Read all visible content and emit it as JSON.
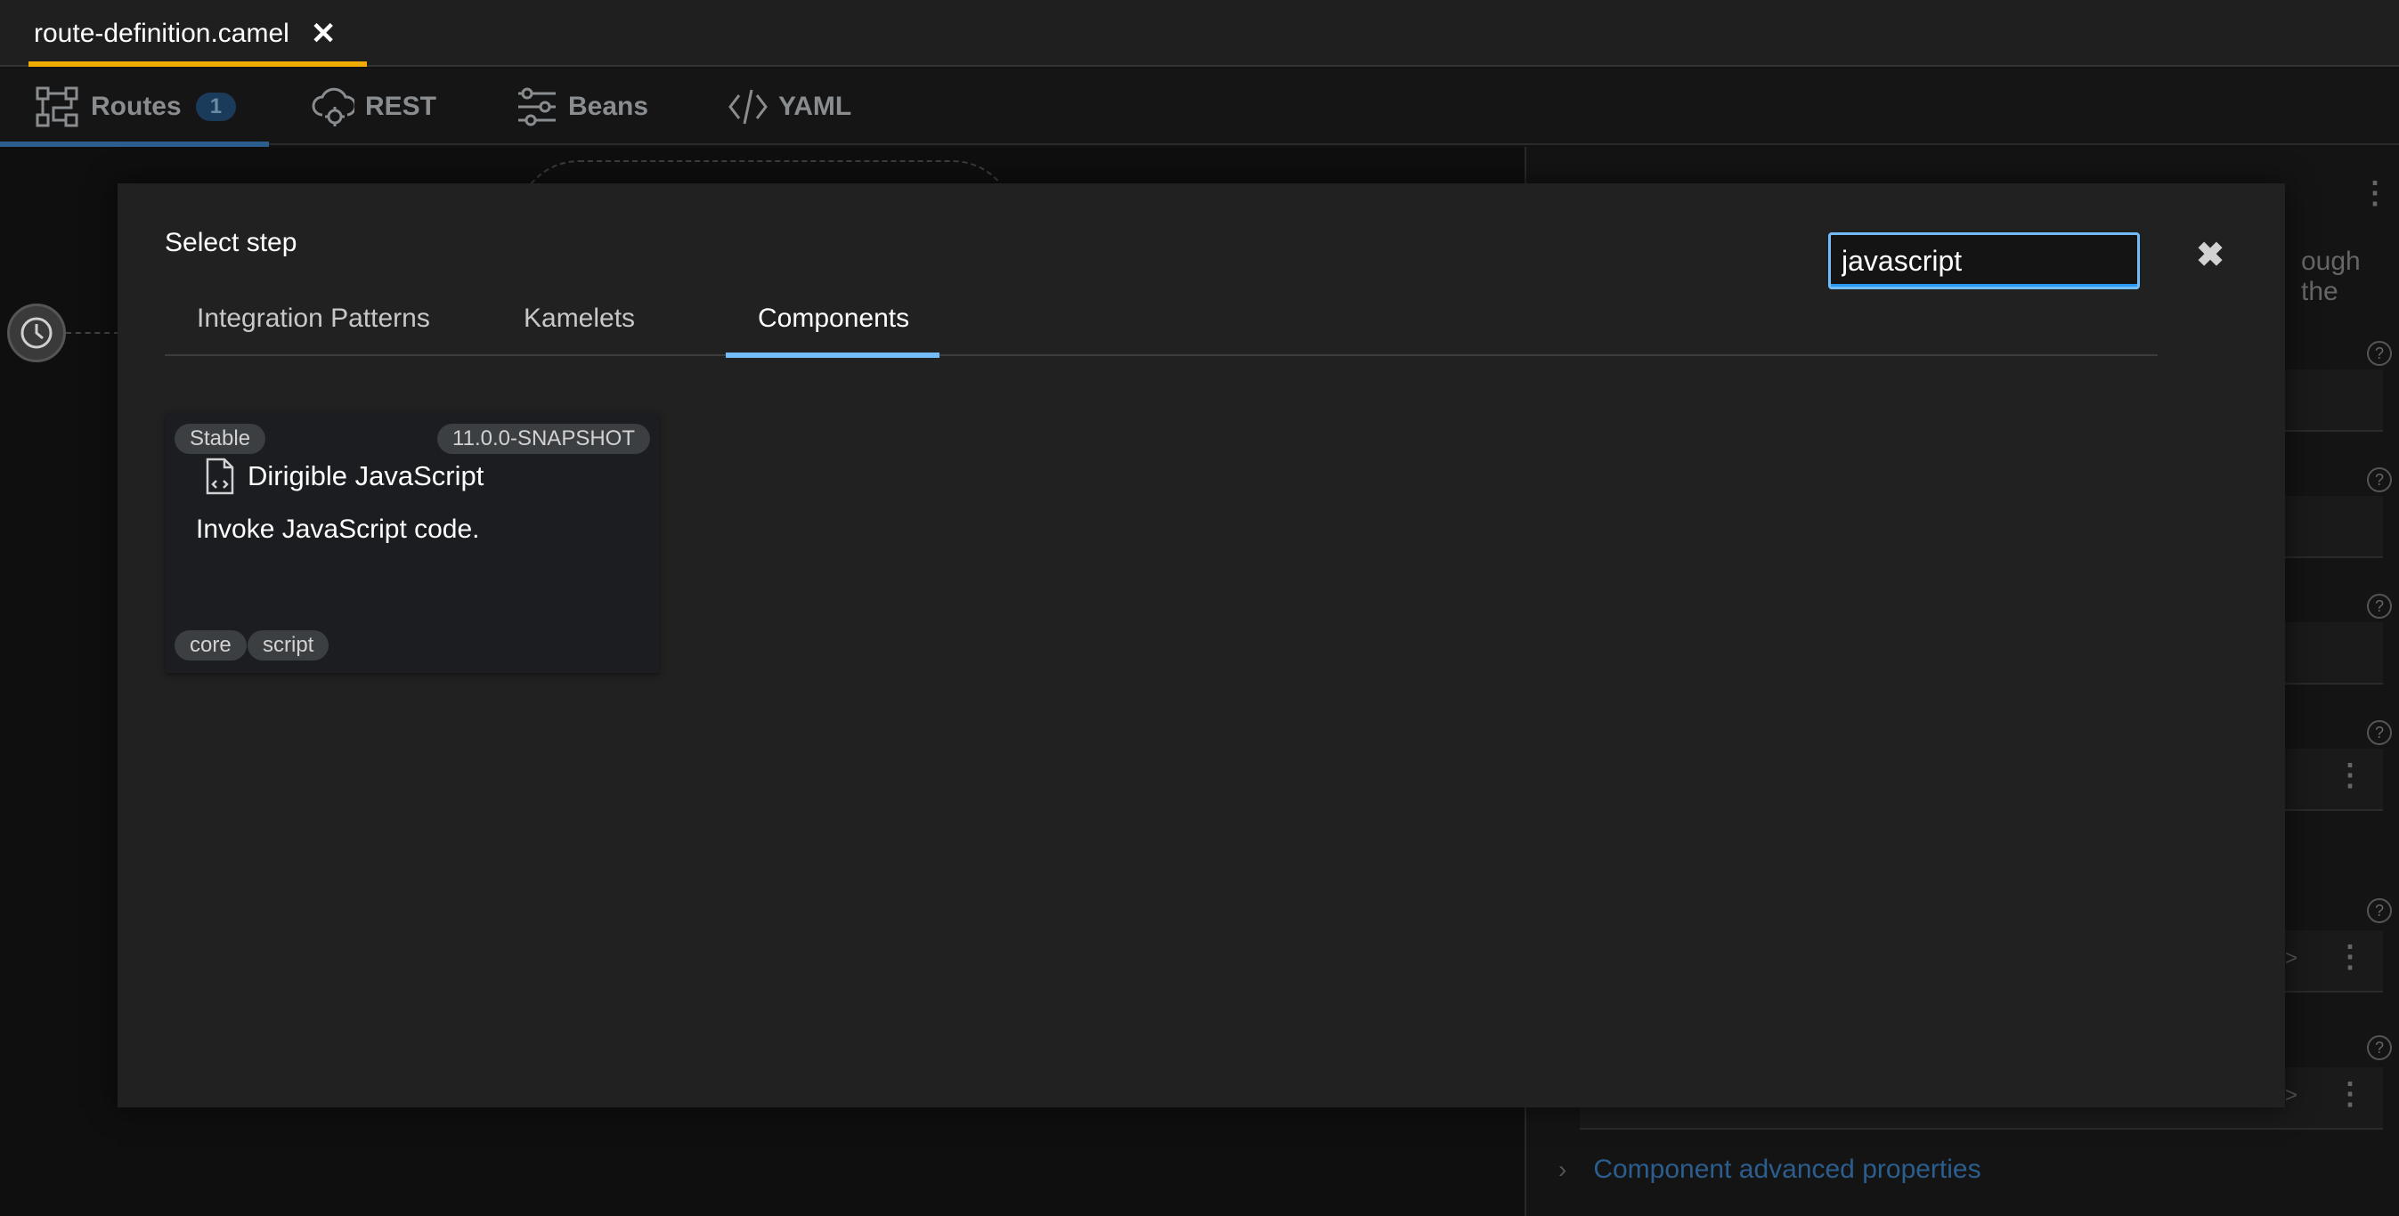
{
  "editor": {
    "tab_label": "route-definition.camel",
    "close_glyph": "✕"
  },
  "view_tabs": {
    "routes_label": "Routes",
    "routes_count": "1",
    "rest_label": "REST",
    "beans_label": "Beans",
    "yaml_label": "YAML"
  },
  "side_panel": {
    "partial_text": "ough the",
    "advanced_link": "Component advanced properties"
  },
  "modal": {
    "title": "Select step",
    "search_value": "javascript",
    "close_glyph": "✖",
    "tabs": [
      "Integration Patterns",
      "Kamelets",
      "Components"
    ],
    "active_tab": "Components"
  },
  "tile": {
    "support_level": "Stable",
    "version": "11.0.0-SNAPSHOT",
    "title": "Dirigible JavaScript",
    "description": "Invoke JavaScript code.",
    "tags": [
      "core",
      "script"
    ],
    "icon": "code-file-icon"
  },
  "colors": {
    "accent": "#73bcf7",
    "editor_tab_bar": "#f0ab00",
    "modal_bg": "#212121"
  }
}
